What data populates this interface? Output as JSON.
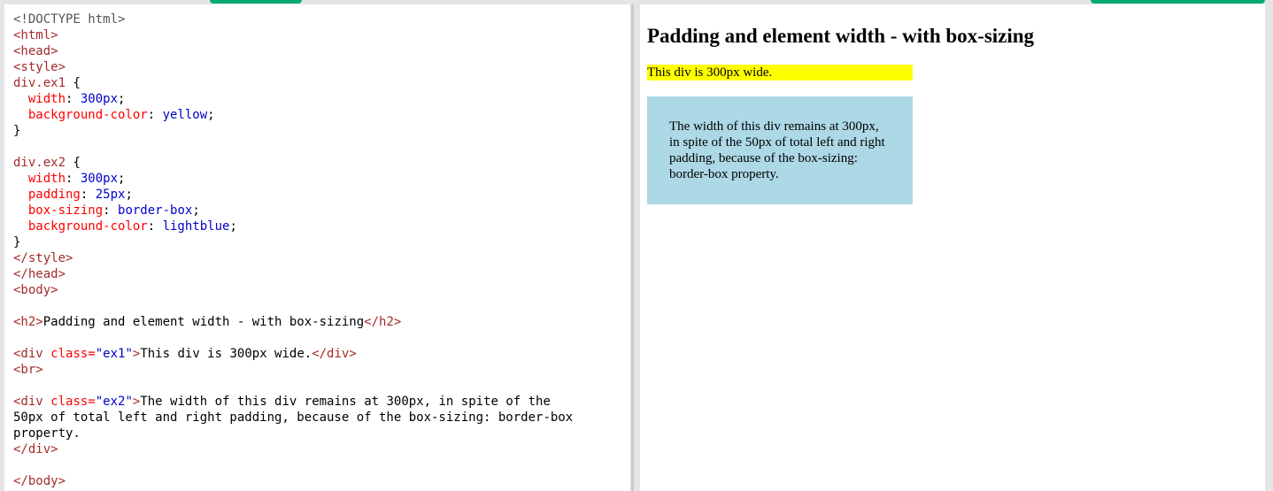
{
  "editor": {
    "code_lines": [
      [
        {
          "t": "doctype",
          "s": "<!DOCTYPE html>"
        }
      ],
      [
        {
          "t": "tag",
          "s": "<html>"
        }
      ],
      [
        {
          "t": "tag",
          "s": "<head>"
        }
      ],
      [
        {
          "t": "tag",
          "s": "<style>"
        }
      ],
      [
        {
          "t": "sel",
          "s": "div.ex1"
        },
        {
          "t": "plain",
          "s": " {"
        }
      ],
      [
        {
          "t": "plain",
          "s": "  "
        },
        {
          "t": "prop",
          "s": "width"
        },
        {
          "t": "plain",
          "s": ": "
        },
        {
          "t": "pval",
          "s": "300px"
        },
        {
          "t": "plain",
          "s": ";"
        }
      ],
      [
        {
          "t": "plain",
          "s": "  "
        },
        {
          "t": "prop",
          "s": "background-color"
        },
        {
          "t": "plain",
          "s": ": "
        },
        {
          "t": "pval",
          "s": "yellow"
        },
        {
          "t": "plain",
          "s": ";"
        }
      ],
      [
        {
          "t": "plain",
          "s": "}"
        }
      ],
      [
        {
          "t": "plain",
          "s": ""
        }
      ],
      [
        {
          "t": "sel",
          "s": "div.ex2"
        },
        {
          "t": "plain",
          "s": " {"
        }
      ],
      [
        {
          "t": "plain",
          "s": "  "
        },
        {
          "t": "prop",
          "s": "width"
        },
        {
          "t": "plain",
          "s": ": "
        },
        {
          "t": "pval",
          "s": "300px"
        },
        {
          "t": "plain",
          "s": ";"
        }
      ],
      [
        {
          "t": "plain",
          "s": "  "
        },
        {
          "t": "prop",
          "s": "padding"
        },
        {
          "t": "plain",
          "s": ": "
        },
        {
          "t": "pval",
          "s": "25px"
        },
        {
          "t": "plain",
          "s": ";"
        }
      ],
      [
        {
          "t": "plain",
          "s": "  "
        },
        {
          "t": "prop",
          "s": "box-sizing"
        },
        {
          "t": "plain",
          "s": ": "
        },
        {
          "t": "pval",
          "s": "border-box"
        },
        {
          "t": "plain",
          "s": ";"
        }
      ],
      [
        {
          "t": "plain",
          "s": "  "
        },
        {
          "t": "prop",
          "s": "background-color"
        },
        {
          "t": "plain",
          "s": ": "
        },
        {
          "t": "pval",
          "s": "lightblue"
        },
        {
          "t": "plain",
          "s": ";"
        }
      ],
      [
        {
          "t": "plain",
          "s": "}"
        }
      ],
      [
        {
          "t": "tag",
          "s": "</style>"
        }
      ],
      [
        {
          "t": "tag",
          "s": "</head>"
        }
      ],
      [
        {
          "t": "tag",
          "s": "<body>"
        }
      ],
      [
        {
          "t": "plain",
          "s": ""
        }
      ],
      [
        {
          "t": "tag",
          "s": "<h2>"
        },
        {
          "t": "plain",
          "s": "Padding and element width - with box-sizing"
        },
        {
          "t": "tag",
          "s": "</h2>"
        }
      ],
      [
        {
          "t": "plain",
          "s": ""
        }
      ],
      [
        {
          "t": "tag",
          "s": "<div "
        },
        {
          "t": "attr",
          "s": "class="
        },
        {
          "t": "val",
          "s": "\"ex1\""
        },
        {
          "t": "tag",
          "s": ">"
        },
        {
          "t": "plain",
          "s": "This div is 300px wide."
        },
        {
          "t": "tag",
          "s": "</div>"
        }
      ],
      [
        {
          "t": "tag",
          "s": "<br>"
        }
      ],
      [
        {
          "t": "plain",
          "s": ""
        }
      ],
      [
        {
          "t": "tag",
          "s": "<div "
        },
        {
          "t": "attr",
          "s": "class="
        },
        {
          "t": "val",
          "s": "\"ex2\""
        },
        {
          "t": "tag",
          "s": ">"
        },
        {
          "t": "plain",
          "s": "The width of this div remains at 300px, in spite of the"
        }
      ],
      [
        {
          "t": "plain",
          "s": "50px of total left and right padding, because of the box-sizing: border-box"
        }
      ],
      [
        {
          "t": "plain",
          "s": "property."
        }
      ],
      [
        {
          "t": "tag",
          "s": "</div>"
        }
      ],
      [
        {
          "t": "plain",
          "s": ""
        }
      ],
      [
        {
          "t": "tag",
          "s": "</body>"
        }
      ]
    ]
  },
  "result": {
    "heading": "Padding and element width - with box-sizing",
    "ex1_text": "This div is 300px wide.",
    "ex2_text": "The width of this div remains at 300px, in spite of the 50px of total left and right padding, because of the box-sizing: border-box property."
  },
  "colors": {
    "accent": "#04aa6d",
    "tag": "#a52a2a",
    "attr": "#ff0000",
    "value": "#0000cd",
    "ex1_bg": "yellow",
    "ex2_bg": "lightblue"
  }
}
